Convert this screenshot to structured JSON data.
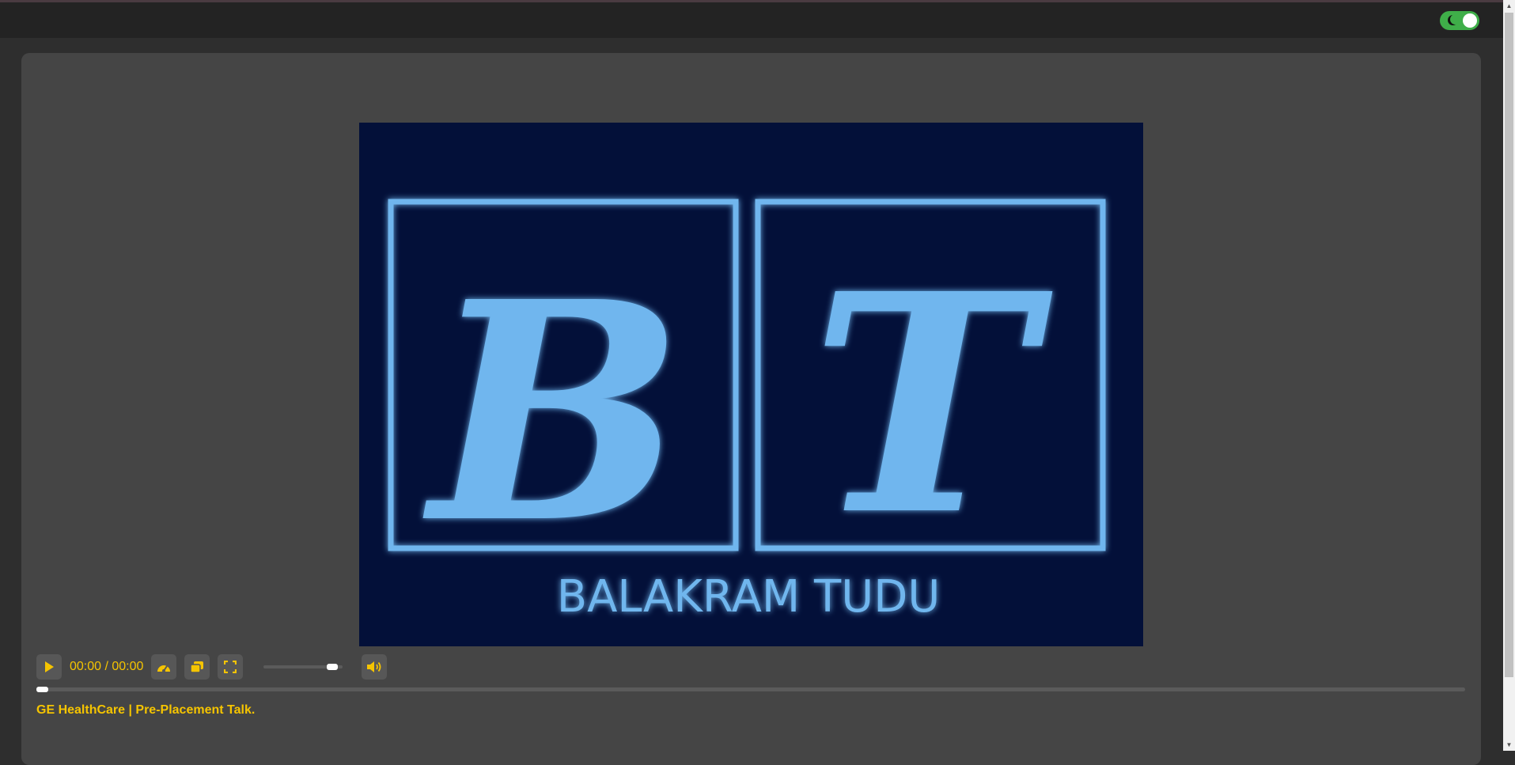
{
  "header": {
    "theme_toggle": {
      "state": "dark",
      "color": "#3fae49"
    }
  },
  "player": {
    "logo": {
      "letters": [
        "B",
        "T"
      ],
      "name": "BALAKRAM TUDU",
      "background": "#031039",
      "accent": "#6fb6ee"
    },
    "controls": {
      "play_icon": "play-icon",
      "time": "00:00 / 00:00",
      "speed_icon": "speedometer-icon",
      "pip_icon": "picture-in-picture-icon",
      "fullscreen_icon": "fullscreen-icon",
      "volume_icon": "volume-up-icon",
      "volume_level": 0.92,
      "accent": "#f5c400"
    },
    "progress": 0.0,
    "title": "GE HealthCare | Pre-Placement Talk."
  },
  "scrollbar": {
    "up_glyph": "▲",
    "down_glyph": "▼"
  }
}
